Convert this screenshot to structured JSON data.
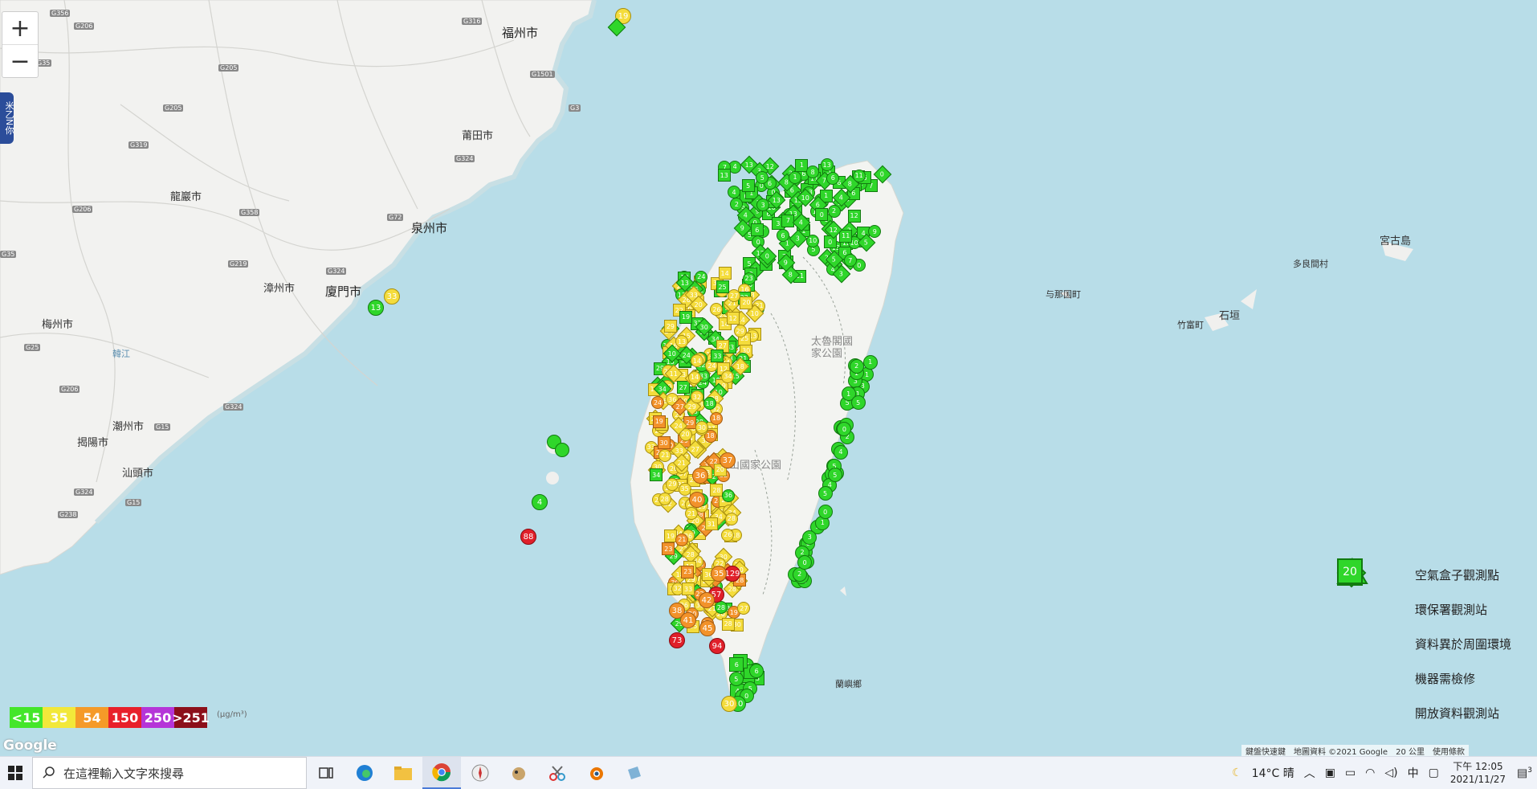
{
  "map": {
    "controls": {
      "zoom_in": "+",
      "zoom_out": "−"
    },
    "side_tab_label": "米乙N你",
    "cities": [
      {
        "name": "福州市",
        "cls": "big"
      },
      {
        "name": "莆田市",
        "cls": ""
      },
      {
        "name": "泉州市",
        "cls": "big"
      },
      {
        "name": "廈門市",
        "cls": "big"
      },
      {
        "name": "漳州市",
        "cls": ""
      },
      {
        "name": "龍巖市",
        "cls": ""
      },
      {
        "name": "梅州市",
        "cls": ""
      },
      {
        "name": "潮州市",
        "cls": ""
      },
      {
        "name": "揭陽市",
        "cls": ""
      },
      {
        "name": "汕頭市",
        "cls": ""
      },
      {
        "name": "宮古島",
        "cls": ""
      },
      {
        "name": "多良間村",
        "cls": ""
      },
      {
        "name": "与那国町",
        "cls": ""
      },
      {
        "name": "竹富町",
        "cls": ""
      },
      {
        "name": "石垣",
        "cls": ""
      },
      {
        "name": "太魯閣國家公園",
        "cls": ""
      },
      {
        "name": "玉山國家公園",
        "cls": ""
      },
      {
        "name": "蘭嶼鄉",
        "cls": ""
      },
      {
        "name": "韓江",
        "cls": "blue"
      }
    ],
    "roads": [
      "G356",
      "G206",
      "G316",
      "G205",
      "G35",
      "G319",
      "G205",
      "G1501",
      "G3",
      "G324",
      "G206",
      "G358",
      "G72",
      "G219",
      "G324",
      "G25",
      "G206",
      "G324",
      "G15",
      "G324",
      "G15",
      "G238",
      "G35"
    ]
  },
  "markers": {
    "highlight_values": [
      {
        "v": "88",
        "level": "red"
      },
      {
        "v": "73",
        "level": "red"
      },
      {
        "v": "129",
        "level": "red"
      },
      {
        "v": "94",
        "level": "red"
      },
      {
        "v": "57",
        "level": "red"
      },
      {
        "v": "37",
        "level": "orange"
      },
      {
        "v": "36",
        "level": "orange"
      },
      {
        "v": "40",
        "level": "orange"
      },
      {
        "v": "35",
        "level": "orange"
      },
      {
        "v": "38",
        "level": "orange"
      },
      {
        "v": "41",
        "level": "orange"
      },
      {
        "v": "42",
        "level": "orange"
      },
      {
        "v": "45",
        "level": "orange"
      },
      {
        "v": "13",
        "level": "green"
      },
      {
        "v": "4",
        "level": "green"
      },
      {
        "v": "19",
        "level": "yellow"
      },
      {
        "v": "33",
        "level": "yellow"
      },
      {
        "v": "10",
        "level": "green"
      },
      {
        "v": "30",
        "level": "yellow"
      }
    ]
  },
  "legend": {
    "items": [
      {
        "label": "空氣盒子觀測點",
        "shape": "circle",
        "icon": "airbox-icon"
      },
      {
        "label": "環保署觀測站",
        "shape": "diamond",
        "icon": "building-icon"
      },
      {
        "label": "資料異於周圍環境",
        "shape": "house",
        "icon": "house-icon"
      },
      {
        "label": "機器需檢修",
        "shape": "triangle",
        "icon": "cone-icon"
      },
      {
        "label": "開放資料觀測站",
        "shape": "square",
        "icon": "opendata-icon"
      }
    ],
    "sample_value": "20"
  },
  "scale": {
    "unit": "(μg/m³)",
    "bins": [
      {
        "label": "<15",
        "color": "#44e62a"
      },
      {
        "label": "35",
        "color": "#f2e83a"
      },
      {
        "label": "54",
        "color": "#f59a28"
      },
      {
        "label": "150",
        "color": "#e8202a"
      },
      {
        "label": "250",
        "color": "#b535d8"
      },
      {
        "label": ">251",
        "color": "#8c0f1a"
      }
    ]
  },
  "attribution": {
    "google": "Google",
    "shortcuts": "鍵盤快速鍵",
    "mapdata": "地圖資料 ©2021 Google",
    "scale": "20 公里",
    "terms": "使用條款"
  },
  "taskbar": {
    "search_placeholder": "在這裡輸入文字來搜尋",
    "weather": "14°C  晴",
    "ime": "中",
    "time": "下午 12:05",
    "date": "2021/11/27",
    "notif_count": "3"
  }
}
